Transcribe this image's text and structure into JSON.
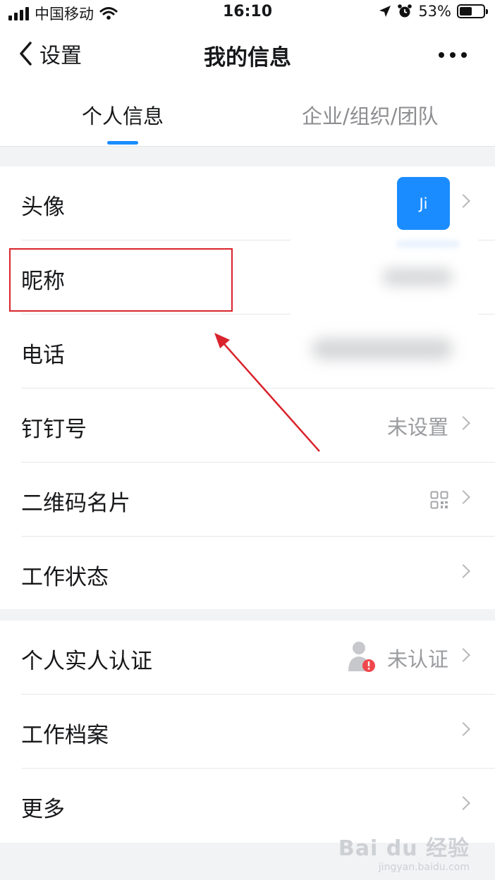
{
  "status_bar": {
    "carrier": "中国移动",
    "time": "16:10",
    "battery_percent": "53%",
    "battery_level": 0.53,
    "icons": [
      "signal-icon",
      "wifi-icon",
      "location-icon",
      "alarm-icon",
      "battery-icon"
    ]
  },
  "nav": {
    "back_label": "设置",
    "title": "我的信息",
    "more_icon": "more-icon"
  },
  "tabs": [
    {
      "label": "个人信息",
      "active": true
    },
    {
      "label": "企业/组织/团队",
      "active": false
    }
  ],
  "profile": {
    "avatar_initials": "Ji",
    "rows": [
      {
        "label": "头像"
      },
      {
        "label": "昵称"
      },
      {
        "label": "电话"
      },
      {
        "label": "钉钉号",
        "value": "未设置"
      },
      {
        "label": "二维码名片"
      },
      {
        "label": "工作状态"
      }
    ]
  },
  "more_group": {
    "rows": [
      {
        "label": "个人实人认证",
        "value": "未认证"
      },
      {
        "label": "工作档案"
      },
      {
        "label": "更多"
      }
    ]
  },
  "colors": {
    "accent": "#1a8cff",
    "highlight": "#d9242c",
    "badge": "#f0474c"
  },
  "watermark": {
    "brand": "Bai du 经验",
    "url": "jingyan.baidu.com"
  }
}
